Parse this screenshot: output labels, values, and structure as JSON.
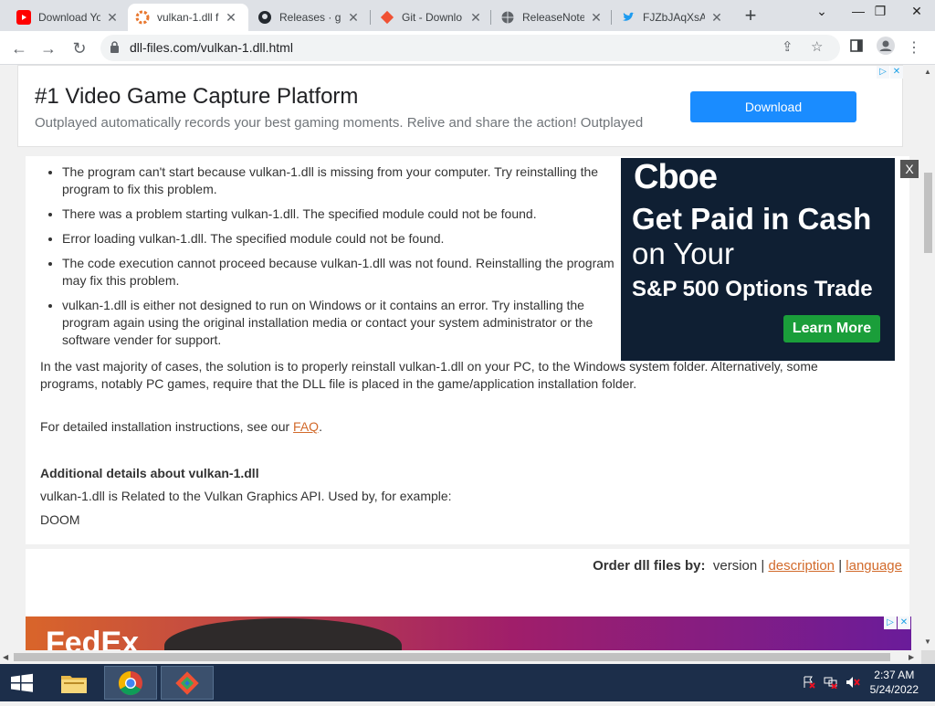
{
  "browser": {
    "tabs": [
      {
        "title": "Download Yo",
        "favicon": "youtube-icon",
        "color": "#ff0000",
        "active": false
      },
      {
        "title": "vulkan-1.dll f",
        "favicon": "dll-files-icon",
        "color": "#e8772e",
        "active": true
      },
      {
        "title": "Releases · gi",
        "favicon": "github-icon",
        "color": "#24292f",
        "active": false
      },
      {
        "title": "Git - Downlo",
        "favicon": "git-icon",
        "color": "#f05133",
        "active": false
      },
      {
        "title": "ReleaseNote",
        "favicon": "globe-icon",
        "color": "#5f6368",
        "active": false
      },
      {
        "title": "FJZbJAqXsA",
        "favicon": "twitter-icon",
        "color": "#1d9bf0",
        "active": false
      }
    ],
    "new_tab_label": "+",
    "url": "dll-files.com/vulkan-1.dll.html"
  },
  "top_ad": {
    "headline": "#1 Video Game Capture Platform",
    "subtext": "Outplayed automatically records your best gaming moments. Relive and share the action! Outplayed",
    "cta": "Download"
  },
  "content": {
    "errors": [
      "The program can't start because vulkan-1.dll is missing from your computer. Try reinstalling the program to fix this problem.",
      "There was a problem starting vulkan-1.dll. The specified module could not be found.",
      "Error loading vulkan-1.dll. The specified module could not be found.",
      "The code execution cannot proceed because vulkan-1.dll was not found. Reinstalling the program may fix this problem.",
      "vulkan-1.dll is either not designed to run on Windows or it contains an error. Try installing the program again using the original installation media or contact your system administrator or the software vender for support."
    ],
    "solution_paragraph": "In the vast majority of cases, the solution is to properly reinstall vulkan-1.dll on your PC, to the Windows system folder. Alternatively, some programs, notably PC games, require that the DLL file is placed in the game/application installation folder.",
    "instructions_prefix": "For detailed installation instructions, see our ",
    "faq_link": "FAQ",
    "instructions_suffix": ".",
    "details_heading": "Additional details about vulkan-1.dll",
    "details_text": "vulkan-1.dll is Related to the Vulkan Graphics API. Used by, for example:",
    "example_program": "DOOM"
  },
  "side_ad": {
    "brand": "Cboe",
    "line1": "Get Paid in Cash",
    "line2": "on Your",
    "line3": "S&P 500 Options Trade",
    "cta": "Learn More",
    "close_label": "X"
  },
  "order_bar": {
    "label": "Order dll files by:",
    "current": "version",
    "sep1": "|",
    "option_description": "description",
    "sep2": "|",
    "option_language": "language"
  },
  "bottom_ad": {
    "brand": "FedEx"
  },
  "taskbar": {
    "time": "2:37 AM",
    "date": "5/24/2022"
  }
}
